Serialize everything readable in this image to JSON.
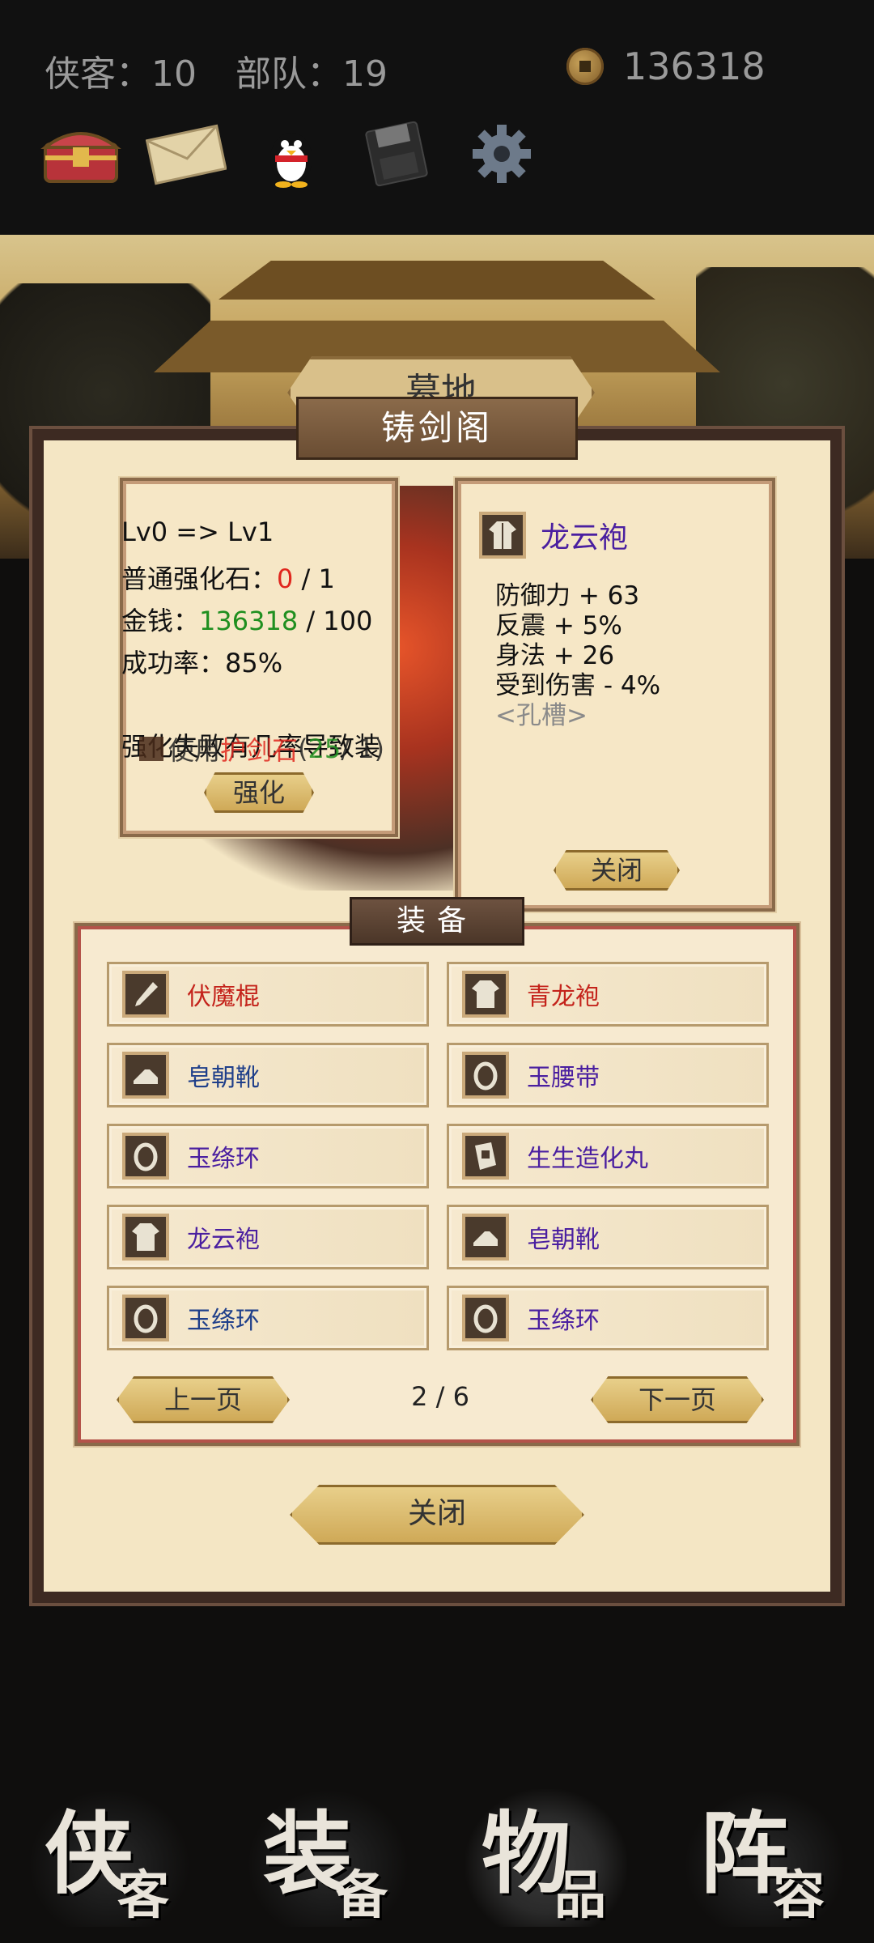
{
  "header": {
    "heroes_label": "侠客：10",
    "troops_label": "部队：19",
    "money": "136318"
  },
  "toolbar": [
    "chest-icon",
    "mail-icon",
    "qq-penguin-icon",
    "save-icon",
    "settings-gear-icon"
  ],
  "scene": {
    "sign": "墓地"
  },
  "dialog": {
    "title": "铸剑阁",
    "upgrade": {
      "level": "Lv0 => Lv1",
      "stone_label": "普通强化石：",
      "stone_have": "0",
      "stone_need": " / 1",
      "money_label": "金钱：",
      "money_have": "136318",
      "money_need": " / 100",
      "success": "成功率：85%",
      "warning": "强化失败有几率导致装",
      "protect_label_pre": "使用",
      "protect_item": "护剑石",
      "protect_count_pre": "(",
      "protect_count": "25",
      "protect_count_post": " / 1)",
      "button": "强化"
    },
    "item": {
      "name": "龙云袍",
      "attrs": [
        "防御力 + 63",
        "反震 + 5%",
        "身法 + 26",
        "受到伤害 - 4%"
      ],
      "slot": "<孔槽>",
      "close": "关闭"
    },
    "equip": {
      "title": "装备",
      "items": [
        {
          "name": "伏魔棍",
          "color": "#c4231b",
          "icon": "staff-icon"
        },
        {
          "name": "青龙袍",
          "color": "#c4231b",
          "icon": "robe-icon"
        },
        {
          "name": "皂朝靴",
          "color": "#1f3f8a",
          "icon": "boot-icon"
        },
        {
          "name": "玉腰带",
          "color": "#4a1fa0",
          "icon": "ring-icon"
        },
        {
          "name": "玉绦环",
          "color": "#4a1fa0",
          "icon": "ring-icon"
        },
        {
          "name": "生生造化丸",
          "color": "#4a1fa0",
          "icon": "scroll-icon"
        },
        {
          "name": "龙云袍",
          "color": "#4a1fa0",
          "icon": "robe-icon"
        },
        {
          "name": "皂朝靴",
          "color": "#4a1fa0",
          "icon": "boot-icon"
        },
        {
          "name": "玉绦环",
          "color": "#1f3f8a",
          "icon": "ring-icon"
        },
        {
          "name": "玉绦环",
          "color": "#4a1fa0",
          "icon": "ring-icon"
        }
      ],
      "prev": "上一页",
      "page": "2 / 6",
      "next": "下一页"
    },
    "close": "关闭"
  },
  "nav": [
    {
      "big": "侠",
      "small": "客"
    },
    {
      "big": "装",
      "small": "备"
    },
    {
      "big": "物",
      "small": "品"
    },
    {
      "big": "阵",
      "small": "容"
    }
  ]
}
